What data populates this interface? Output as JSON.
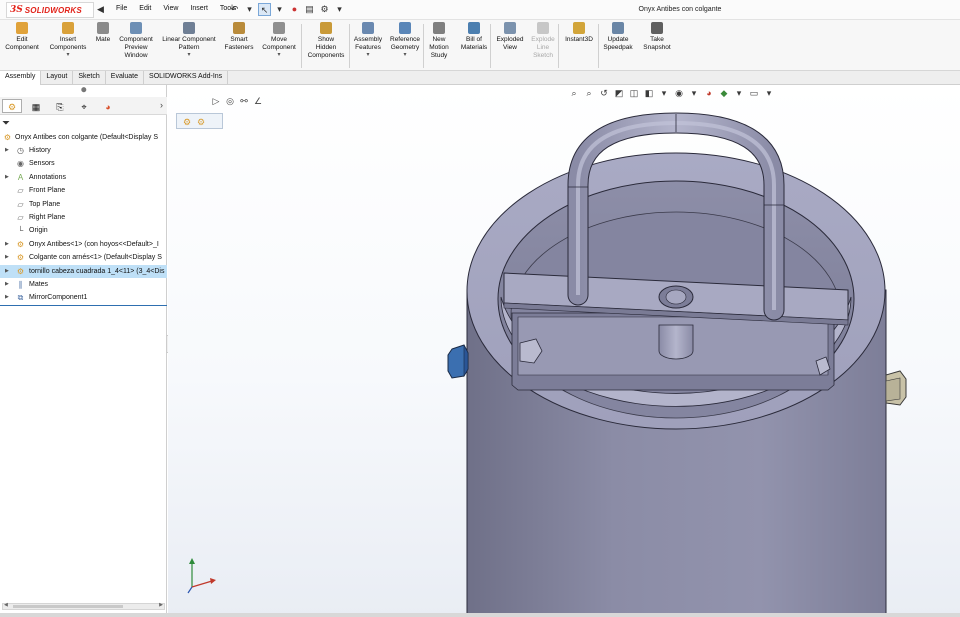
{
  "app": {
    "logo_prefix": "3S",
    "logo_name": "SOLIDWORKS",
    "document_title": "Onyx Antibes con colgante"
  },
  "menu": [
    "File",
    "Edit",
    "View",
    "Insert",
    "Tools"
  ],
  "ribbon": {
    "buttons": [
      {
        "id": "edit-component",
        "label": "Edit\nComponent",
        "color": "#e0a23a"
      },
      {
        "id": "insert-components",
        "label": "Insert\nComponents",
        "color": "#d9a13a",
        "caret": true
      },
      {
        "id": "mate",
        "label": "Mate",
        "color": "#8a8a8a"
      },
      {
        "id": "component-preview",
        "label": "Component\nPreview\nWindow",
        "color": "#6d8fb5"
      },
      {
        "id": "linear-pattern",
        "label": "Linear Component\nPattern",
        "color": "#6f7f95",
        "caret": true
      },
      {
        "id": "smart-fasteners",
        "label": "Smart\nFasteners",
        "color": "#b98b3b"
      },
      {
        "id": "move-component",
        "label": "Move\nComponent",
        "color": "#8f8f8f",
        "caret": true
      },
      {
        "id": "show-hidden",
        "label": "Show\nHidden\nComponents",
        "color": "#c99a38"
      },
      {
        "id": "assembly-features",
        "label": "Assembly\nFeatures",
        "color": "#6a89b0",
        "caret": true
      },
      {
        "id": "reference-geometry",
        "label": "Reference\nGeometry",
        "color": "#5a86b8",
        "caret": true
      },
      {
        "id": "new-motion-study",
        "label": "New\nMotion\nStudy",
        "color": "#7f7f7f"
      },
      {
        "id": "bill-of-materials",
        "label": "Bill of\nMaterials",
        "color": "#4c7fb0"
      },
      {
        "id": "exploded-view",
        "label": "Exploded\nView",
        "color": "#7b92ad"
      },
      {
        "id": "explode-line-sketch",
        "label": "Explode\nLine\nSketch",
        "color": "#c7c7c7",
        "disabled": true
      },
      {
        "id": "instant3d",
        "label": "Instant3D",
        "color": "#d2a53a"
      },
      {
        "id": "update-speedpak",
        "label": "Update\nSpeedpak",
        "color": "#6a86a6"
      },
      {
        "id": "take-snapshot",
        "label": "Take\nSnapshot",
        "color": "#5f5f5f"
      }
    ]
  },
  "tabs": [
    "Assembly",
    "Layout",
    "Sketch",
    "Evaluate",
    "SOLIDWORKS Add-Ins"
  ],
  "tree": {
    "root": "Onyx Antibes con colgante  (Default<Display S",
    "items": [
      {
        "label": "History",
        "icon": "history-icon",
        "exp": true
      },
      {
        "label": "Sensors",
        "icon": "sensor-icon",
        "exp": false
      },
      {
        "label": "Annotations",
        "icon": "annotation-icon",
        "exp": true
      },
      {
        "label": "Front Plane",
        "icon": "plane-icon",
        "exp": false
      },
      {
        "label": "Top Plane",
        "icon": "plane-icon",
        "exp": false
      },
      {
        "label": "Right Plane",
        "icon": "plane-icon",
        "exp": false
      },
      {
        "label": "Origin",
        "icon": "origin-icon",
        "exp": false
      },
      {
        "label": "Onyx Antibes<1> (con hoyos<<Default>_I",
        "icon": "part-icon",
        "exp": true
      },
      {
        "label": "Colgante con arnés<1> (Default<Display S",
        "icon": "part-icon",
        "exp": true
      },
      {
        "label": "tornillo cabeza cuadrada 1_4<11> (3_4<Dis",
        "icon": "part-icon",
        "exp": true,
        "selected": true
      },
      {
        "label": "Mates",
        "icon": "mates-icon",
        "exp": true
      },
      {
        "label": "MirrorComponent1",
        "icon": "mirror-icon",
        "exp": true
      }
    ]
  }
}
